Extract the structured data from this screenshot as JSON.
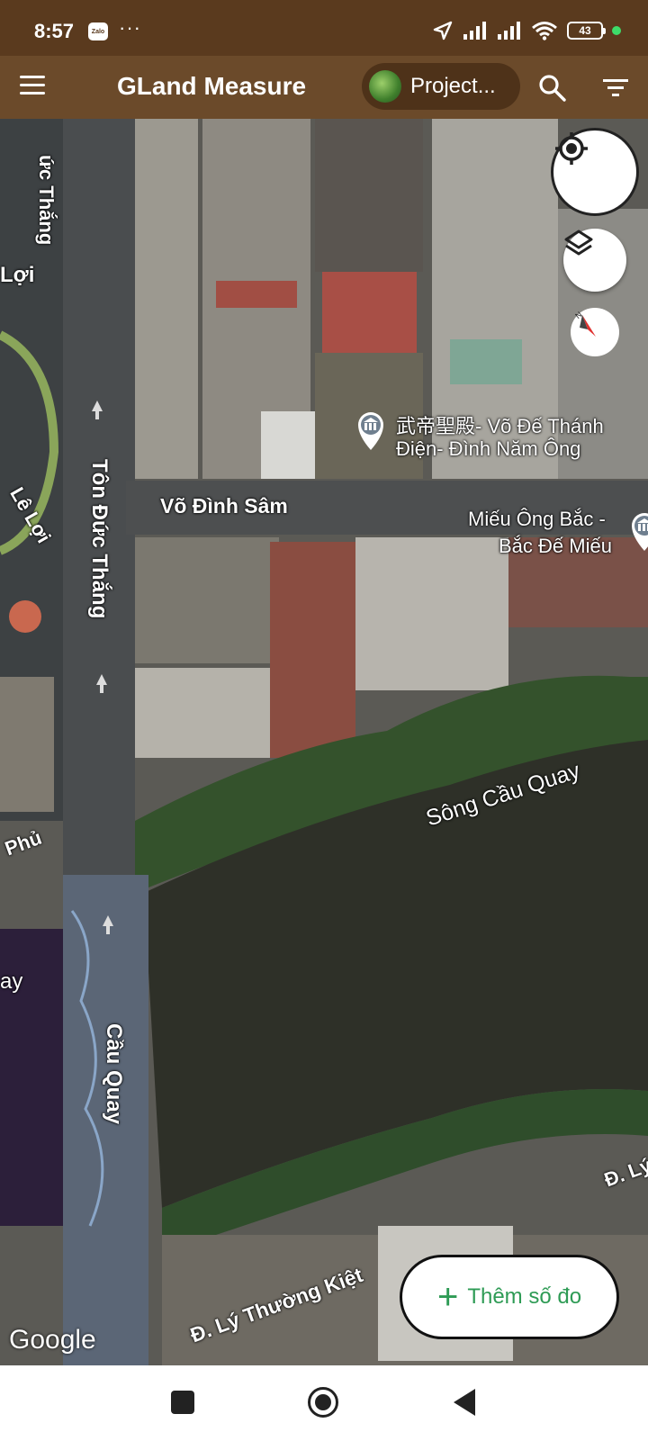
{
  "status_bar": {
    "time": "8:57",
    "notification_app": "Zalo",
    "more_notifications": "···",
    "battery_level": "43",
    "icons": [
      "location-arrow-icon",
      "signal-icon",
      "signal-icon",
      "wifi-icon",
      "battery-icon"
    ]
  },
  "app_bar": {
    "title": "GLand Measure",
    "project_label": "Project...",
    "colors": {
      "background": "#6b4a2a",
      "status_background": "#5a3a1e"
    }
  },
  "map": {
    "labels": {
      "street_ton_duc_thang_top": "ức Thắng",
      "street_le_loi_top": "Lợi",
      "poi_vo_de_line1": "武帝聖殿- Võ Đế Thánh",
      "poi_vo_de_line2": "Điện- Đình Năm Ông",
      "street_vo_dinh_sam": "Võ Đình Sâm",
      "poi_mieu_line1": "Miếu Ông Bắc -",
      "poi_mieu_line2": "Bắc Đế Miếu",
      "street_le_loi_side": "Lê Lợi",
      "street_ton_duc_thang": "Tôn Đức Thắng",
      "river_song_cau_quay": "Sông Cầu Quay",
      "street_phu": "Phủ",
      "street_quay": "ay",
      "bridge_cau_quay": "Cầu Quay",
      "street_ly_thuong_kiet": "Đ. Lý Thường Kiệt",
      "street_d_ly": "Đ. Lý"
    },
    "attribution": "Google"
  },
  "fab": {
    "icon": "plus-icon",
    "label": "Thêm số đo",
    "color": "#2e9b55"
  }
}
